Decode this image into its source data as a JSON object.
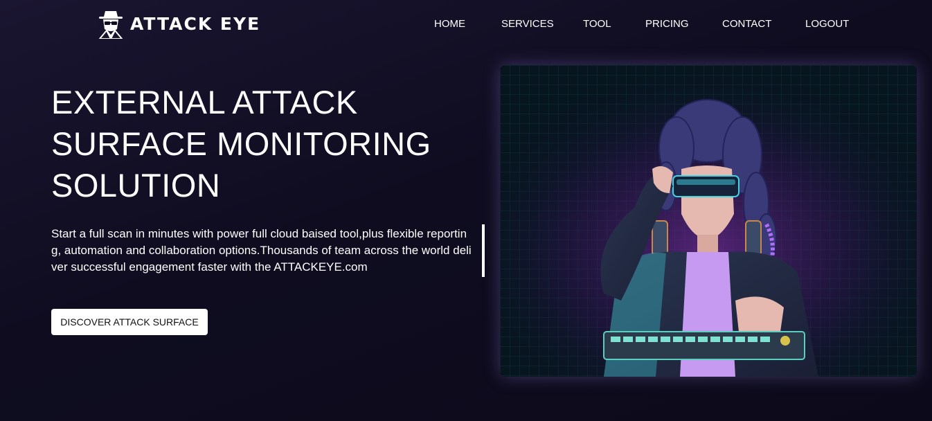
{
  "brand": {
    "name": "ATTACK EYE",
    "logo_icon": "hacker-hat-glasses-icon"
  },
  "nav": {
    "items": [
      {
        "label": "HOME"
      },
      {
        "label": "SERVICES"
      },
      {
        "label": "TOOL"
      },
      {
        "label": "PRICING"
      },
      {
        "label": "CONTACT"
      },
      {
        "label": "LOGOUT"
      }
    ]
  },
  "hero": {
    "title": "EXTERNAL ATTACK SURFACE MONITORING SOLUTION",
    "description": "Start a full scan in minutes with power full cloud baised tool,plus flexible reporting, automation and collaboration options.Thousands of team across the world deliver successful engagement faster with the ATTACKEYE.com",
    "cta_label": "DISCOVER ATTACK SURFACE",
    "illustration": "cyberpunk-hacker-with-keyboard-illustration"
  },
  "colors": {
    "background": "#0f0c20",
    "text": "#ffffff",
    "button_bg": "#ffffff",
    "button_text": "#111111",
    "accent_purple": "#b46cff",
    "accent_cyan": "#3fd4e0"
  }
}
